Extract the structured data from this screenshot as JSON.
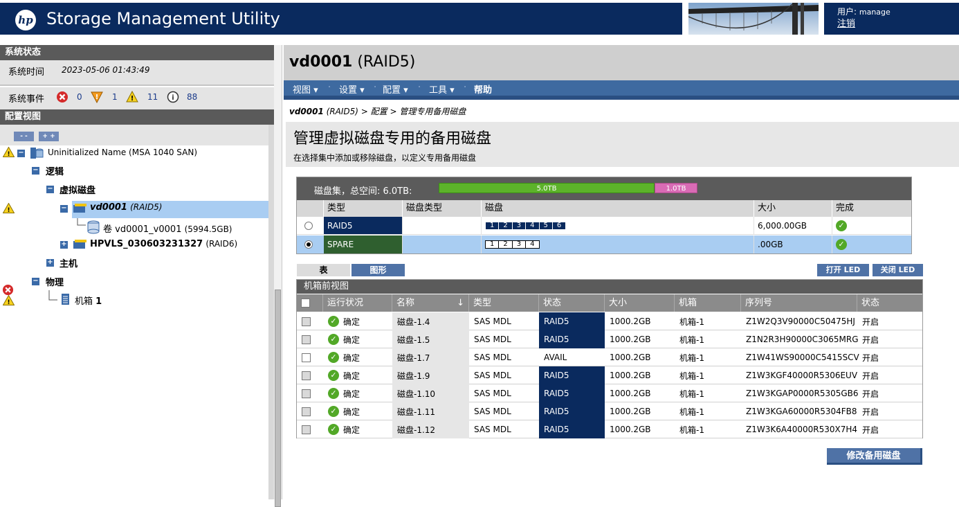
{
  "header": {
    "logo_text": "hp",
    "app_title": "Storage Management Utility",
    "user_label": "用户: ",
    "user_name": "manage",
    "logout": "注销"
  },
  "left": {
    "status_heading": "系统状态",
    "system_time_label": "系统时间",
    "system_time_value": "2023-05-06 01:43:49",
    "events_label": "系统事件",
    "events": {
      "critical": "0",
      "error": "1",
      "warning": "11",
      "info": "88"
    },
    "config_heading": "配置视图",
    "collapse_label": "- -",
    "expand_label": "+ +",
    "tree": {
      "system": "Uninitialized Name (MSA 1040 SAN)",
      "logical": "逻辑",
      "vdisks": "虚拟磁盘",
      "vd1_name": "vd0001",
      "vd1_raid": "(RAID5)",
      "vol_prefix": "卷",
      "vol_name": "vd0001_v0001",
      "vol_size": "(5994.5GB)",
      "vd2_name": "HPVLS_030603231327",
      "vd2_raid": "(RAID6)",
      "hosts": "主机",
      "physical": "物理",
      "enclosure_label": "机箱",
      "enclosure_num": "1"
    }
  },
  "main": {
    "title_name": "vd0001",
    "title_raid": "(RAID5)",
    "menu": [
      "视图",
      "设置",
      "配置",
      "工具",
      "帮助"
    ],
    "breadcrumb": {
      "vd": "vd0001",
      "raid": "(RAID5)",
      "rest": " > 配置 > 管理专用备用磁盘"
    },
    "panel_title": "管理虚拟磁盘专用的备用磁盘",
    "panel_desc": "在选择集中添加或移除磁盘，以定义专用备用磁盘",
    "diskset": {
      "label": "磁盘集，总空间:  6.0TB:",
      "bar_used_label": "5.0TB",
      "bar_spare_label": "1.0TB",
      "bar_used_fraction": 0.833,
      "bar_spare_fraction": 0.167,
      "columns": [
        "类型",
        "磁盘类型",
        "磁盘",
        "大小",
        "完成"
      ],
      "rows": [
        {
          "type": "RAID5",
          "disk_type": "",
          "disks": [
            "1",
            "2",
            "3",
            "4",
            "5",
            "6"
          ],
          "size": "6,000.00GB",
          "selected": false
        },
        {
          "type": "SPARE",
          "disk_type": "",
          "disks": [
            "1",
            "2",
            "3",
            "4"
          ],
          "size": ".00GB",
          "selected": true
        }
      ]
    },
    "tabs": [
      "表",
      "图形"
    ],
    "led_on": "打开 LED",
    "led_off": "关闭 LED",
    "enclosure": {
      "title": "机箱前视图",
      "columns": [
        "运行状况",
        "名称",
        "类型",
        "状态",
        "大小",
        "机箱",
        "序列号",
        "状态"
      ],
      "rows": [
        {
          "checked_style": "grey",
          "health": "确定",
          "name": "磁盘-1.4",
          "type": "SAS MDL",
          "state": "RAID5",
          "size": "1000.2GB",
          "enclosure": "机箱-1",
          "serial": "Z1W2Q3V90000C50475HJ",
          "status": "开启"
        },
        {
          "checked_style": "grey",
          "health": "确定",
          "name": "磁盘-1.5",
          "type": "SAS MDL",
          "state": "RAID5",
          "size": "1000.2GB",
          "enclosure": "机箱-1",
          "serial": "Z1N2R3H90000C3065MRG",
          "status": "开启"
        },
        {
          "checked_style": "white",
          "health": "确定",
          "name": "磁盘-1.7",
          "type": "SAS MDL",
          "state": "AVAIL",
          "size": "1000.2GB",
          "enclosure": "机箱-1",
          "serial": "Z1W41WS90000C5415SCV",
          "status": "开启"
        },
        {
          "checked_style": "grey",
          "health": "确定",
          "name": "磁盘-1.9",
          "type": "SAS MDL",
          "state": "RAID5",
          "size": "1000.2GB",
          "enclosure": "机箱-1",
          "serial": "Z1W3KGF40000R5306EUV",
          "status": "开启"
        },
        {
          "checked_style": "grey",
          "health": "确定",
          "name": "磁盘-1.10",
          "type": "SAS MDL",
          "state": "RAID5",
          "size": "1000.2GB",
          "enclosure": "机箱-1",
          "serial": "Z1W3KGAP0000R5305GB6",
          "status": "开启"
        },
        {
          "checked_style": "grey",
          "health": "确定",
          "name": "磁盘-1.11",
          "type": "SAS MDL",
          "state": "RAID5",
          "size": "1000.2GB",
          "enclosure": "机箱-1",
          "serial": "Z1W3KGA60000R5304FB8",
          "status": "开启"
        },
        {
          "checked_style": "grey",
          "health": "确定",
          "name": "磁盘-1.12",
          "type": "SAS MDL",
          "state": "RAID5",
          "size": "1000.2GB",
          "enclosure": "机箱-1",
          "serial": "Z1W3K6A40000R530X7H4",
          "status": "开启"
        }
      ]
    },
    "modify_button": "修改备用磁盘"
  },
  "colors": {
    "brand_navy": "#0a2a5e",
    "menu_blue": "#3e6aa0",
    "raid_navy": "#0a2a5e",
    "spare_green": "#2f5f2f",
    "used_green": "#5cb32a",
    "spare_pink": "#d96bb5",
    "selected_row": "#a9cdf2"
  }
}
